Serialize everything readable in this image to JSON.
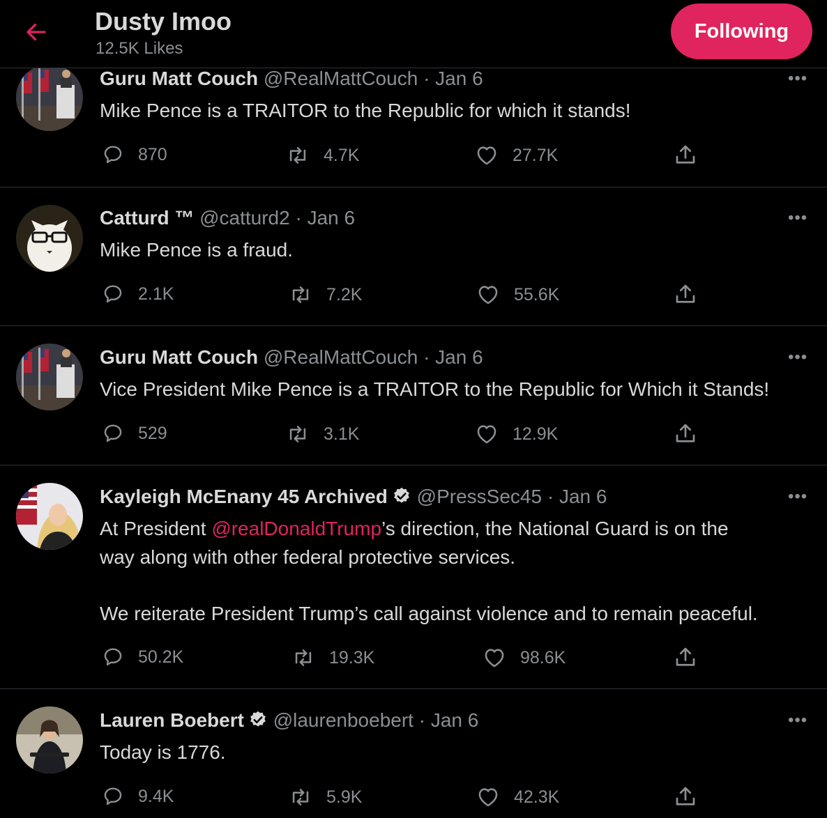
{
  "header": {
    "title": "Dusty Imoo",
    "subtitle": "12.5K Likes",
    "follow_label": "Following",
    "back_icon": "back-arrow-icon",
    "accent_color": "#e0245e"
  },
  "tweets": [
    {
      "name": "Guru Matt Couch",
      "handle": "@RealMattCouch",
      "date": "· Jan 6",
      "text": "Mike Pence is a TRAITOR to the Republic for which it stands!",
      "replies": "870",
      "retweets": "4.7K",
      "likes": "27.7K"
    },
    {
      "name": "Catturd ™",
      "handle": "@catturd2",
      "date": "· Jan 6",
      "text": "Mike Pence is a fraud.",
      "replies": "2.1K",
      "retweets": "7.2K",
      "likes": "55.6K"
    },
    {
      "name": "Guru Matt Couch",
      "handle": "@RealMattCouch",
      "date": "· Jan 6",
      "text": "Vice President Mike Pence is a TRAITOR to the Republic for Which it Stands!",
      "replies": "529",
      "retweets": "3.1K",
      "likes": "12.9K"
    },
    {
      "name": "Kayleigh McEnany 45 Archived",
      "handle": "@PressSec45",
      "date": "· Jan 6",
      "verified": true,
      "text_pre": "At President ",
      "mention": "@realDonaldTrump",
      "text_post": "’s direction, the National Guard is on the",
      "text_line2": "way along with other federal protective services.",
      "text_line3": "We reiterate President Trump’s call against violence and to remain peaceful.",
      "replies": "50.2K",
      "retweets": "19.3K",
      "likes": "98.6K"
    },
    {
      "name": "Lauren Boebert",
      "handle": "@laurenboebert",
      "date": "· Jan 6",
      "verified": true,
      "text": "Today is 1776.",
      "replies": "9.4K",
      "retweets": "5.9K",
      "likes": "42.3K"
    }
  ],
  "icons": {
    "reply": "reply-icon",
    "retweet": "retweet-icon",
    "like": "heart-icon",
    "share": "share-icon",
    "more": "more-icon"
  }
}
